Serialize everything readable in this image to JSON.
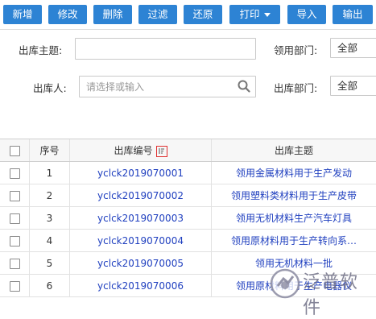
{
  "toolbar": {
    "buttons": [
      "新增",
      "修改",
      "删除",
      "过滤",
      "还原",
      "打印",
      "导入",
      "输出"
    ]
  },
  "filters": {
    "subject_label": "出库主题:",
    "subject_value": "",
    "use_dept_label": "领用部门:",
    "use_dept_value": "全部",
    "person_label": "出库人:",
    "person_placeholder": "请选择或输入",
    "out_dept_label": "出库部门:",
    "out_dept_value": "全部"
  },
  "table": {
    "headers": {
      "index": "序号",
      "code": "出库编号",
      "subject": "出库主题"
    },
    "rows": [
      {
        "index": "1",
        "code": "yclck2019070001",
        "subject": "领用金属材料用于生产发动"
      },
      {
        "index": "2",
        "code": "yclck2019070002",
        "subject": "领用塑料类材料用于生产皮带"
      },
      {
        "index": "3",
        "code": "yclck2019070003",
        "subject": "领用无机材料生产汽车灯具"
      },
      {
        "index": "4",
        "code": "yclck2019070004",
        "subject": "领用原材料用于生产转向系…"
      },
      {
        "index": "5",
        "code": "yclck2019070005",
        "subject": "领用无机材料一批"
      },
      {
        "index": "6",
        "code": "yclck2019070006",
        "subject": "领用原材料用于生产电器仪"
      }
    ]
  },
  "watermark": {
    "text": "泛普软件"
  },
  "colors": {
    "button": "#2d83d4",
    "link": "#1f3fbf",
    "sort_icon": "#e03030"
  }
}
